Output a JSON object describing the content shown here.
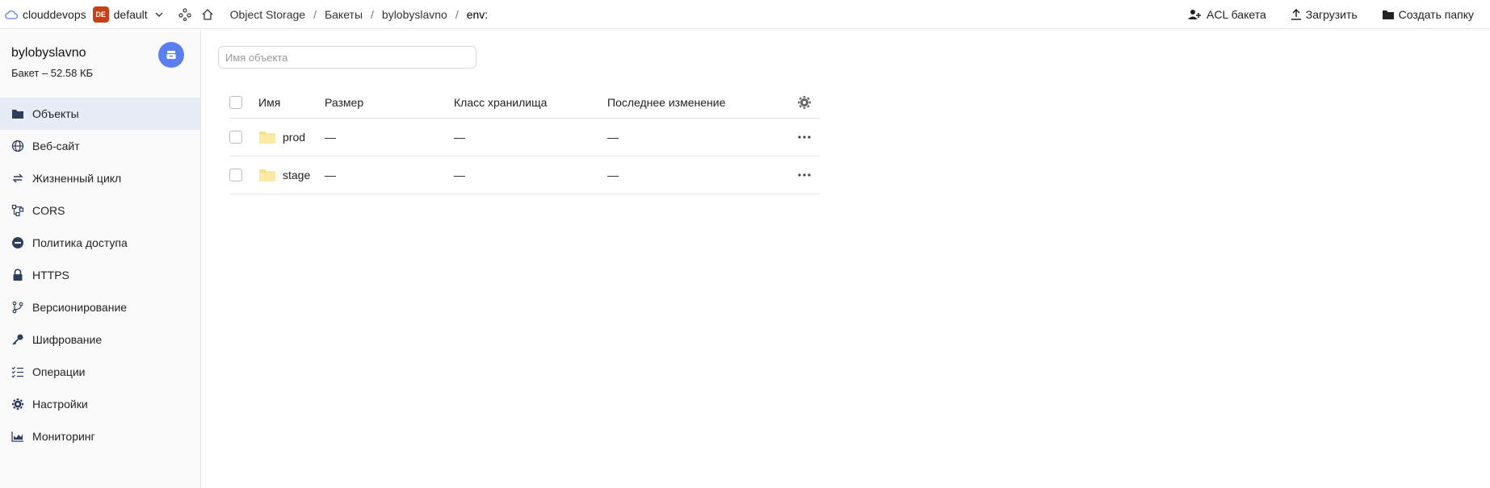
{
  "topbar": {
    "cloud_name": "clouddevops",
    "folder_badge": "DE",
    "folder_name": "default",
    "breadcrumbs": [
      "Object Storage",
      "Бакеты",
      "bylobyslavno",
      "env:"
    ],
    "separator": "/",
    "actions": {
      "acl": "ACL бакета",
      "upload": "Загрузить",
      "create_folder": "Создать папку"
    }
  },
  "sidebar": {
    "bucket_name": "bylobyslavno",
    "bucket_meta": "Бакет – 52.58 КБ",
    "items": [
      {
        "label": "Объекты",
        "icon": "folder-icon",
        "active": true
      },
      {
        "label": "Веб-сайт",
        "icon": "globe-icon"
      },
      {
        "label": "Жизненный цикл",
        "icon": "cycle-icon"
      },
      {
        "label": "CORS",
        "icon": "cors-icon"
      },
      {
        "label": "Политика доступа",
        "icon": "minus-circle-icon"
      },
      {
        "label": "HTTPS",
        "icon": "lock-icon"
      },
      {
        "label": "Версионирование",
        "icon": "branch-icon"
      },
      {
        "label": "Шифрование",
        "icon": "key-icon"
      },
      {
        "label": "Операции",
        "icon": "checklist-icon"
      },
      {
        "label": "Настройки",
        "icon": "gear-icon"
      },
      {
        "label": "Мониторинг",
        "icon": "chart-icon"
      }
    ]
  },
  "main": {
    "search_placeholder": "Имя объекта",
    "columns": {
      "name": "Имя",
      "size": "Размер",
      "storage_class": "Класс хранилища",
      "modified": "Последнее изменение"
    },
    "rows": [
      {
        "name": "prod",
        "size": "—",
        "storage_class": "—",
        "modified": "—"
      },
      {
        "name": "stage",
        "size": "—",
        "storage_class": "—",
        "modified": "—"
      }
    ]
  },
  "colors": {
    "accent": "#5b7ff0",
    "folder_badge": "#c6401a",
    "active_nav": "#e8ecf6",
    "folder": "#f7e08a"
  }
}
